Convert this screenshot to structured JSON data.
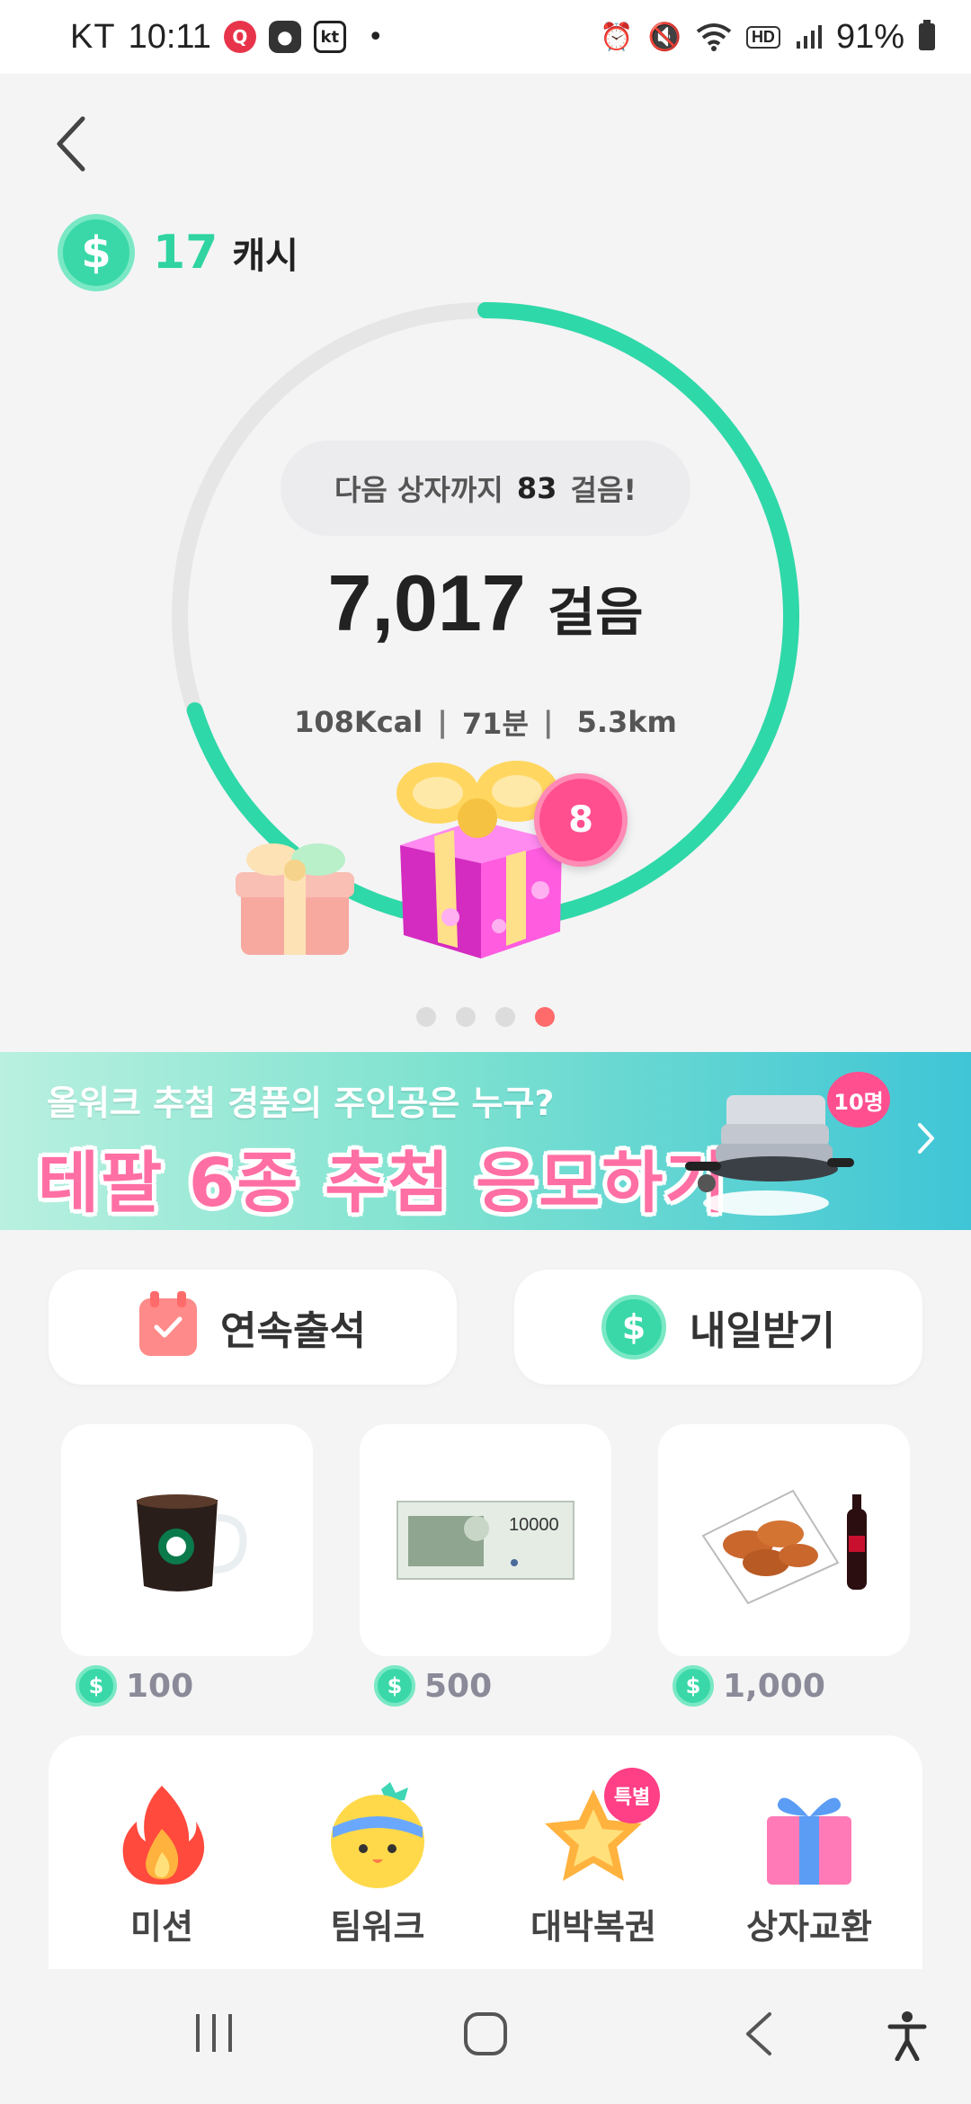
{
  "status_bar": {
    "carrier": "KT",
    "time": "10:11",
    "app_icons": [
      "q-app-icon",
      "talk-app-icon",
      "kt-app-icon"
    ],
    "kt_label": "kt",
    "dot": "•",
    "battery": "91%"
  },
  "header": {
    "back_icon": "chevron-left-icon",
    "cash_symbol": "$",
    "cash_amount": "17",
    "cash_unit": "캐시"
  },
  "progress": {
    "goal_prefix": "다음 상자까지",
    "goal_steps": "83",
    "goal_suffix": "걸음!",
    "steps": "7,017",
    "steps_unit": "걸음",
    "kcal": "108Kcal",
    "minutes": "71분",
    "distance": "5.3km",
    "separator": "|",
    "ring_fraction": 0.7,
    "gift_count": "8",
    "accent": "#2fd8a8",
    "track": "#e6e6e6"
  },
  "pager": {
    "total": 4,
    "active_index": 3
  },
  "banner": {
    "subtitle": "올워크 추첨 경품의 주인공은 누구?",
    "title": "테팔 6종 추첨 응모하기",
    "badge": "10명"
  },
  "actions": {
    "attendance_label": "연속출석",
    "tomorrow_label": "내일받기",
    "coin_symbol": "$"
  },
  "rewards": [
    {
      "price": "100",
      "item": "coffee-mug"
    },
    {
      "price": "500",
      "item": "gift-voucher",
      "voucher_value": "10000"
    },
    {
      "price": "1,000",
      "item": "chicken-and-cola"
    }
  ],
  "menu": [
    {
      "label": "미션",
      "icon": "fire-icon"
    },
    {
      "label": "팀워크",
      "icon": "smiley-icon"
    },
    {
      "label": "대박복권",
      "icon": "star-icon",
      "badge": "특별"
    },
    {
      "label": "상자교환",
      "icon": "gift-box-icon"
    }
  ]
}
